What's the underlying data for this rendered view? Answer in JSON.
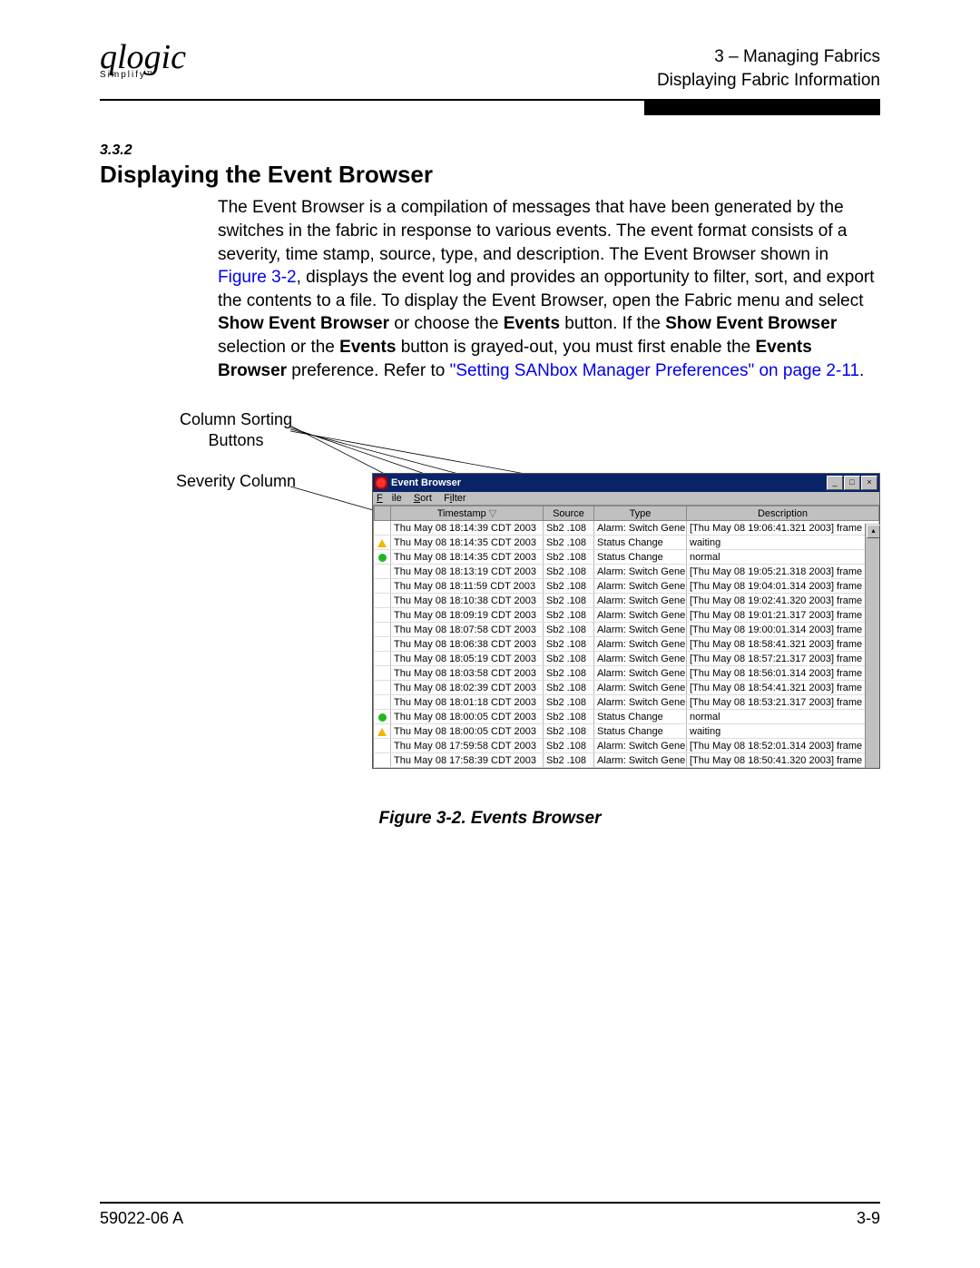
{
  "header": {
    "chapter_line": "3 – Managing Fabrics",
    "section_line": "Displaying Fabric Information",
    "logo_main": "qlogic",
    "logo_sub": "Simplify™"
  },
  "section": {
    "number": "3.3.2",
    "title": "Displaying the Event Browser"
  },
  "paragraph": {
    "p1": "The Event Browser is a compilation of messages that have been generated by the switches in the fabric in response to various events. The event format consists of a severity, time stamp, source, type, and description. The Event Browser shown in ",
    "link1": "Figure 3-2",
    "p2": ", displays the event log and provides an opportunity to filter, sort, and export the contents to a file. To display the Event Browser, open the Fabric menu and select ",
    "b1": "Show Event Browser",
    "p3": " or choose the ",
    "b2": "Events",
    "p4": " button. If the ",
    "b3": "Show Event Browser",
    "p5": " selection or the ",
    "b4": "Events",
    "p6": " button is grayed-out, you must first enable the ",
    "b5": "Events Browser",
    "p7": " preference. Refer to ",
    "link2": "\"Setting SANbox Manager Preferences\" on page 2-11",
    "p8": "."
  },
  "callouts": {
    "sorting": "Column Sorting Buttons",
    "severity": "Severity Column"
  },
  "browser": {
    "title": "Event Browser",
    "menu": {
      "file": "File",
      "sort": "Sort",
      "filter": "Filter"
    },
    "columns": {
      "sev": "",
      "timestamp": "Timestamp",
      "sort_indicator": "▽",
      "source": "Source",
      "type": "Type",
      "description": "Description"
    },
    "rows": [
      {
        "sev": "",
        "ts": "Thu May 08 18:14:39 CDT 2003",
        "src": "Sb2 .108",
        "type": "Alarm: Switch Gene...",
        "desc": "[Thu May 08 19:06:41.321 2003] frame r..."
      },
      {
        "sev": "warn",
        "ts": "Thu May 08 18:14:35 CDT 2003",
        "src": "Sb2 .108",
        "type": "Status Change",
        "desc": "waiting"
      },
      {
        "sev": "green",
        "ts": "Thu May 08 18:14:35 CDT 2003",
        "src": "Sb2 .108",
        "type": "Status Change",
        "desc": "normal"
      },
      {
        "sev": "",
        "ts": "Thu May 08 18:13:19 CDT 2003",
        "src": "Sb2 .108",
        "type": "Alarm: Switch Gene...",
        "desc": "[Thu May 08 19:05:21.318 2003] frame r..."
      },
      {
        "sev": "",
        "ts": "Thu May 08 18:11:59 CDT 2003",
        "src": "Sb2 .108",
        "type": "Alarm: Switch Gene...",
        "desc": "[Thu May 08 19:04:01.314 2003] frame r..."
      },
      {
        "sev": "",
        "ts": "Thu May 08 18:10:38 CDT 2003",
        "src": "Sb2 .108",
        "type": "Alarm: Switch Gene...",
        "desc": "[Thu May 08 19:02:41.320 2003] frame r..."
      },
      {
        "sev": "",
        "ts": "Thu May 08 18:09:19 CDT 2003",
        "src": "Sb2 .108",
        "type": "Alarm: Switch Gene...",
        "desc": "[Thu May 08 19:01:21.317 2003] frame r..."
      },
      {
        "sev": "",
        "ts": "Thu May 08 18:07:58 CDT 2003",
        "src": "Sb2 .108",
        "type": "Alarm: Switch Gene...",
        "desc": "[Thu May 08 19:00:01.314 2003] frame r..."
      },
      {
        "sev": "",
        "ts": "Thu May 08 18:06:38 CDT 2003",
        "src": "Sb2 .108",
        "type": "Alarm: Switch Gene...",
        "desc": "[Thu May 08 18:58:41.321 2003] frame r..."
      },
      {
        "sev": "",
        "ts": "Thu May 08 18:05:19 CDT 2003",
        "src": "Sb2 .108",
        "type": "Alarm: Switch Gene...",
        "desc": "[Thu May 08 18:57:21.317 2003] frame r..."
      },
      {
        "sev": "",
        "ts": "Thu May 08 18:03:58 CDT 2003",
        "src": "Sb2 .108",
        "type": "Alarm: Switch Gene...",
        "desc": "[Thu May 08 18:56:01.314 2003] frame r..."
      },
      {
        "sev": "",
        "ts": "Thu May 08 18:02:39 CDT 2003",
        "src": "Sb2 .108",
        "type": "Alarm: Switch Gene...",
        "desc": "[Thu May 08 18:54:41.321 2003] frame r..."
      },
      {
        "sev": "",
        "ts": "Thu May 08 18:01:18 CDT 2003",
        "src": "Sb2 .108",
        "type": "Alarm: Switch Gene...",
        "desc": "[Thu May 08 18:53:21.317 2003] frame r..."
      },
      {
        "sev": "green",
        "ts": "Thu May 08 18:00:05 CDT 2003",
        "src": "Sb2 .108",
        "type": "Status Change",
        "desc": "normal"
      },
      {
        "sev": "warn",
        "ts": "Thu May 08 18:00:05 CDT 2003",
        "src": "Sb2 .108",
        "type": "Status Change",
        "desc": "waiting"
      },
      {
        "sev": "",
        "ts": "Thu May 08 17:59:58 CDT 2003",
        "src": "Sb2 .108",
        "type": "Alarm: Switch Gene...",
        "desc": "[Thu May 08 18:52:01.314 2003] frame r..."
      },
      {
        "sev": "",
        "ts": "Thu May 08 17:58:39 CDT 2003",
        "src": "Sb2 .108",
        "type": "Alarm: Switch Gene...",
        "desc": "[Thu May 08 18:50:41.320 2003] frame r..."
      }
    ]
  },
  "figure_caption": "Figure 3-2.  Events Browser",
  "footer": {
    "doc_id": "59022-06  A",
    "page_num": "3-9"
  }
}
